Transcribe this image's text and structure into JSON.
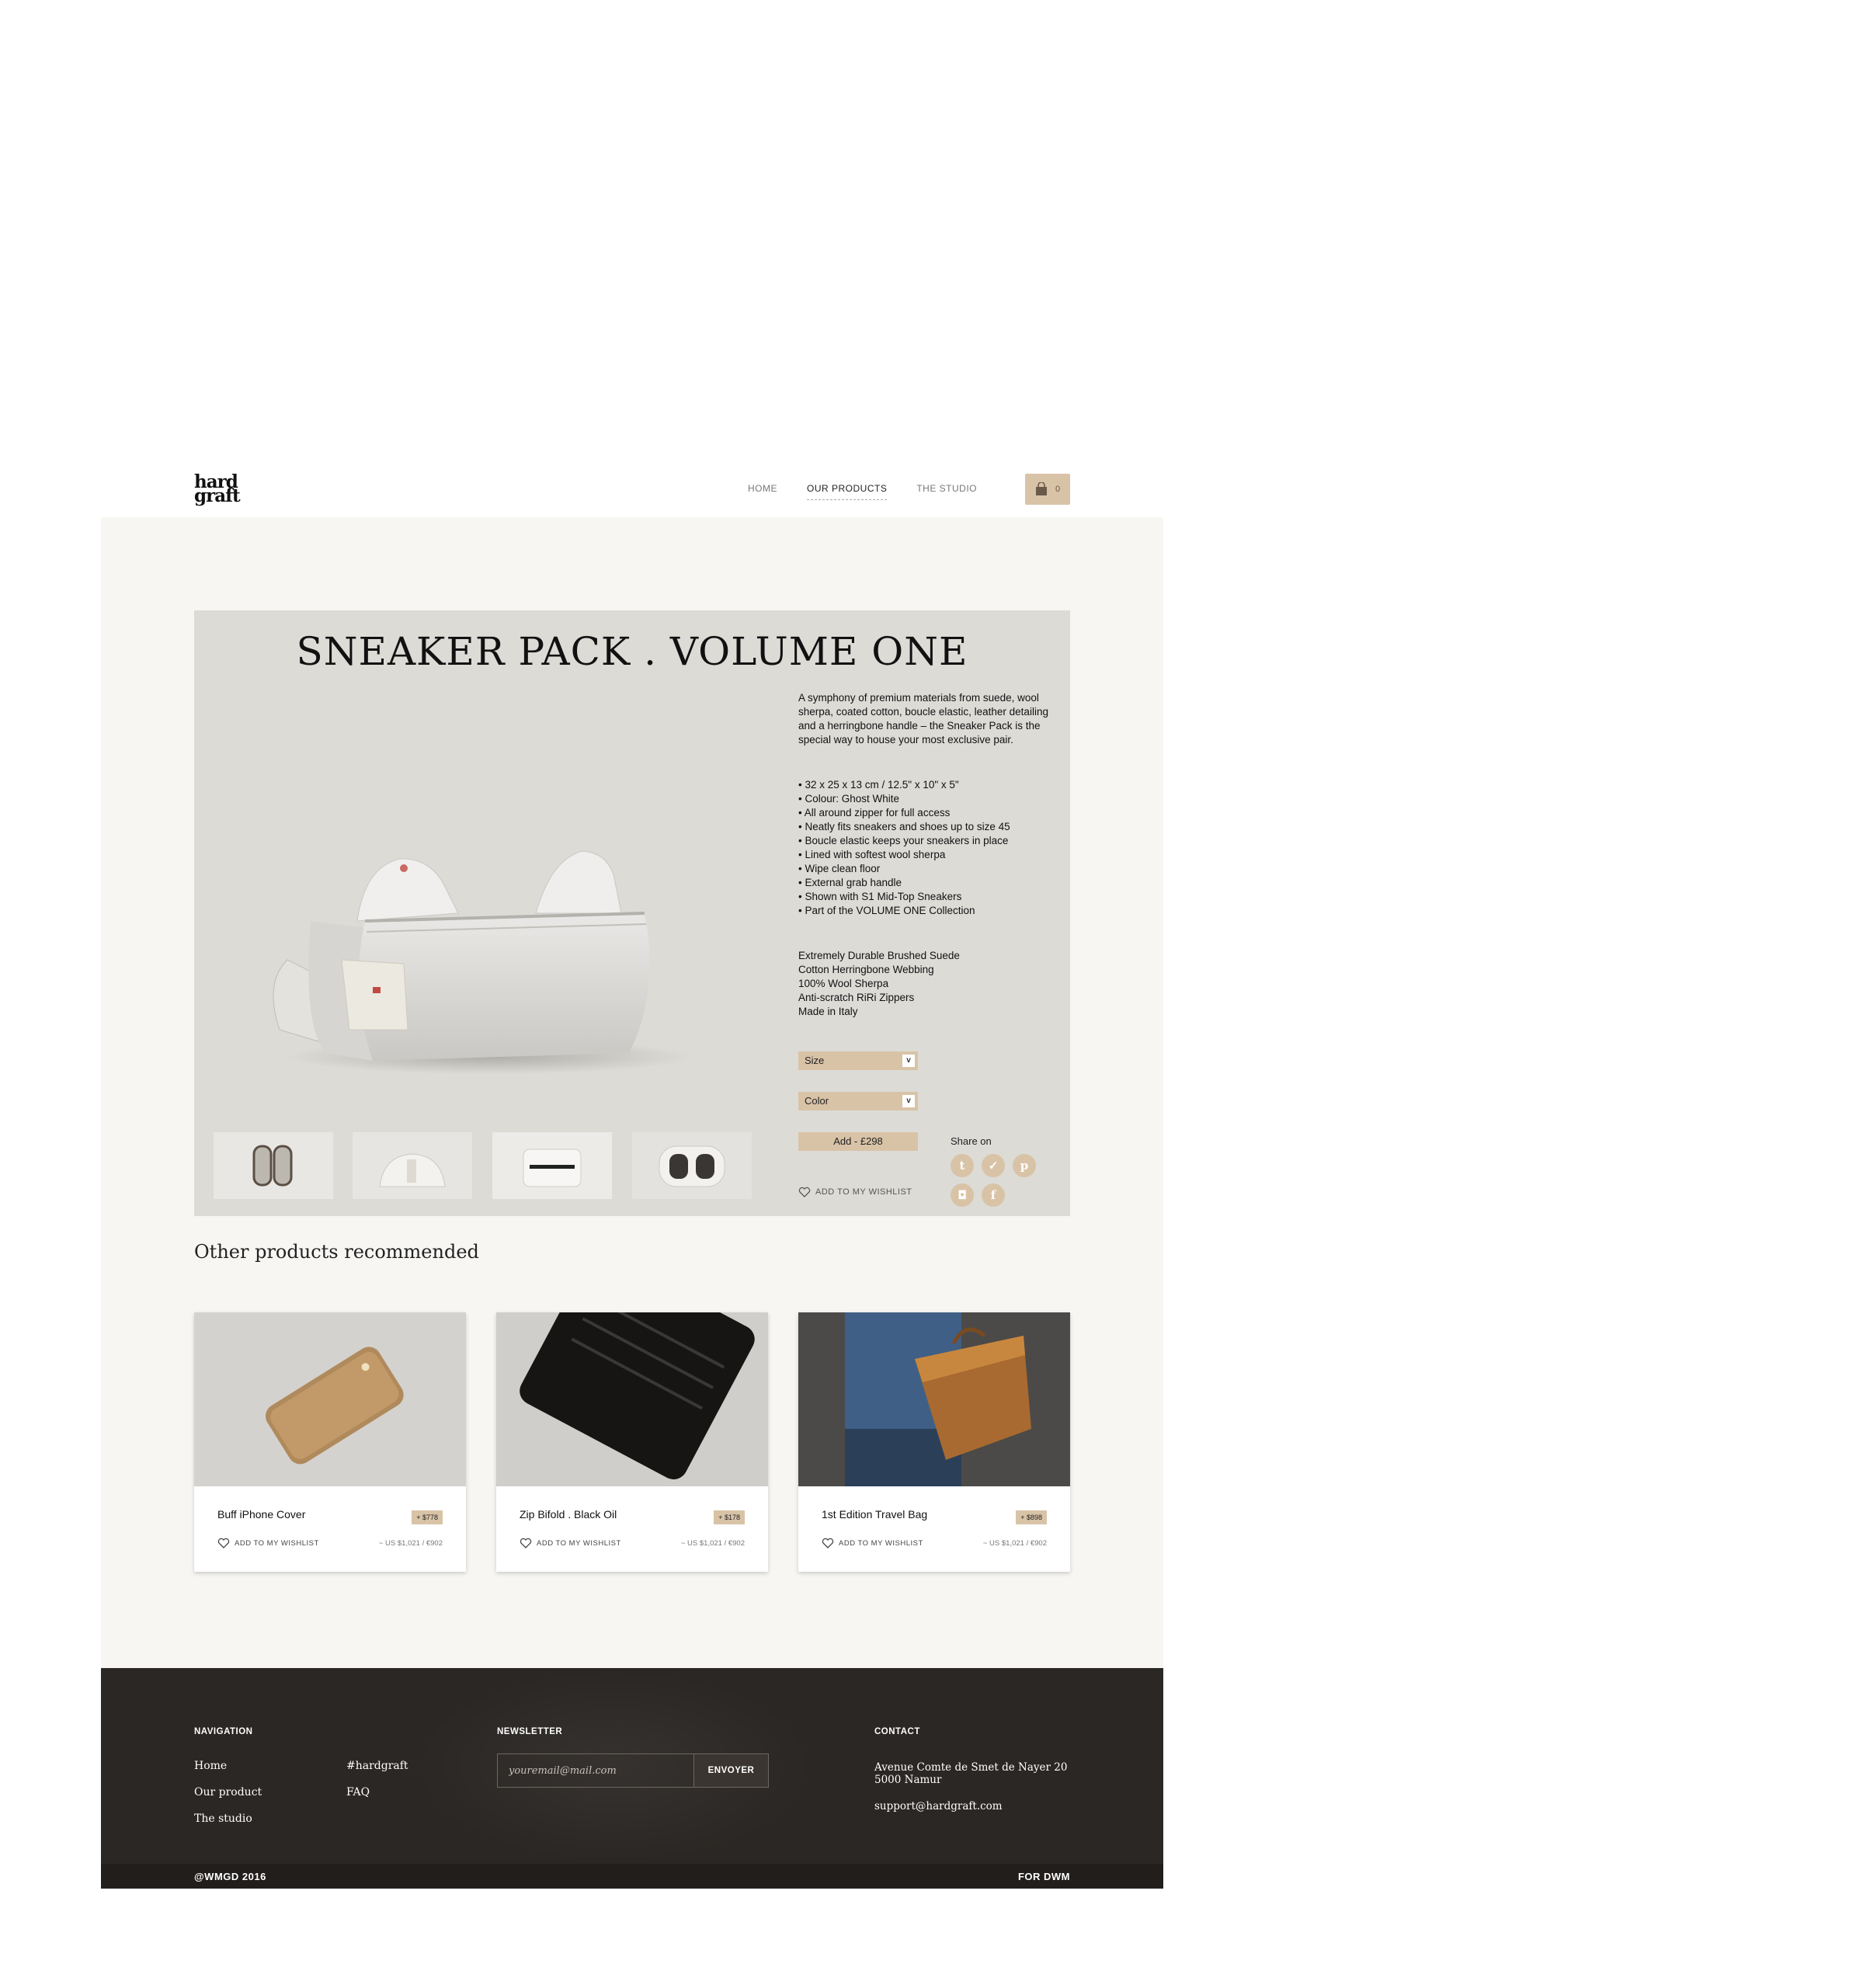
{
  "brand": {
    "logo_line1": "hard",
    "logo_line2": "graft"
  },
  "nav": {
    "items": [
      {
        "label": "HOME"
      },
      {
        "label": "OUR PRODUCTS",
        "active": true
      },
      {
        "label": "THE STUDIO"
      }
    ],
    "cart_count": "0"
  },
  "product": {
    "title": "SNEAKER PACK . VOLUME ONE",
    "description": "A symphony of premium materials from suede, wool sherpa, coated cotton, boucle elastic, leather detailing and a herringbone handle – the Sneaker Pack is the special way to house your most exclusive pair.",
    "specs": [
      "• 32 x 25 x 13 cm / 12.5\" x  10\" x 5\"",
      "• Colour: Ghost White",
      "• All around zipper for full access",
      "• Neatly fits sneakers and shoes up to size 45",
      "• Boucle elastic keeps your sneakers in place",
      "• Lined with softest wool sherpa",
      "• Wipe clean floor",
      "• External grab handle",
      "• Shown with S1 Mid-Top Sneakers",
      "• Part of the VOLUME ONE Collection"
    ],
    "materials": [
      "Extremely Durable Brushed Suede",
      "Cotton Herringbone Webbing",
      "100% Wool Sherpa",
      "Anti-scratch RiRi Zippers",
      "Made in Italy"
    ],
    "size_label": "Size",
    "color_label": "Color",
    "select_arrow": "v",
    "add_label": "Add - £298",
    "wishlist_label": "ADD TO MY WISHLIST",
    "share_label": "Share on",
    "social": [
      {
        "icon": "tumblr-icon",
        "glyph": "t"
      },
      {
        "icon": "twitter-icon",
        "glyph": "✓"
      },
      {
        "icon": "pinterest-icon",
        "glyph": "p"
      },
      {
        "icon": "instagram-icon",
        "glyph": "◘"
      },
      {
        "icon": "facebook-icon",
        "glyph": "f"
      }
    ]
  },
  "recommended": {
    "title": "Other products recommended",
    "items": [
      {
        "name": "Buff iPhone Cover",
        "price": "+ $778",
        "wishlist": "ADD TO MY WISHLIST",
        "conversion": "~ US $1,021 /  €902"
      },
      {
        "name": "Zip Bifold . Black Oil",
        "price": "+ $178",
        "wishlist": "ADD TO MY WISHLIST",
        "conversion": "~ US $1,021 /  €902"
      },
      {
        "name": "1st Edition Travel Bag",
        "price": "+ $898",
        "wishlist": "ADD TO MY WISHLIST",
        "conversion": "~ US $1,021 /  €902"
      }
    ]
  },
  "footer": {
    "navigation_heading": "NAVIGATION",
    "nav_links": [
      "Home",
      "Our product",
      "The studio",
      "#hardgraft",
      "FAQ"
    ],
    "newsletter_heading": "NEWSLETTER",
    "newsletter_placeholder": "youremail@mail.com",
    "newsletter_button": "ENVOYER",
    "contact_heading": "CONTACT",
    "address_line1": "Avenue Comte de Smet de Nayer 20",
    "address_line2": "5000 Namur",
    "email": "support@hardgraft.com",
    "copyright": "@WMGD 2016",
    "credit": "FOR DWM"
  },
  "colors": {
    "accent": "#d9c3a7",
    "panel": "#dcdbd6",
    "page": "#f7f6f3",
    "footer": "#2b2724"
  }
}
